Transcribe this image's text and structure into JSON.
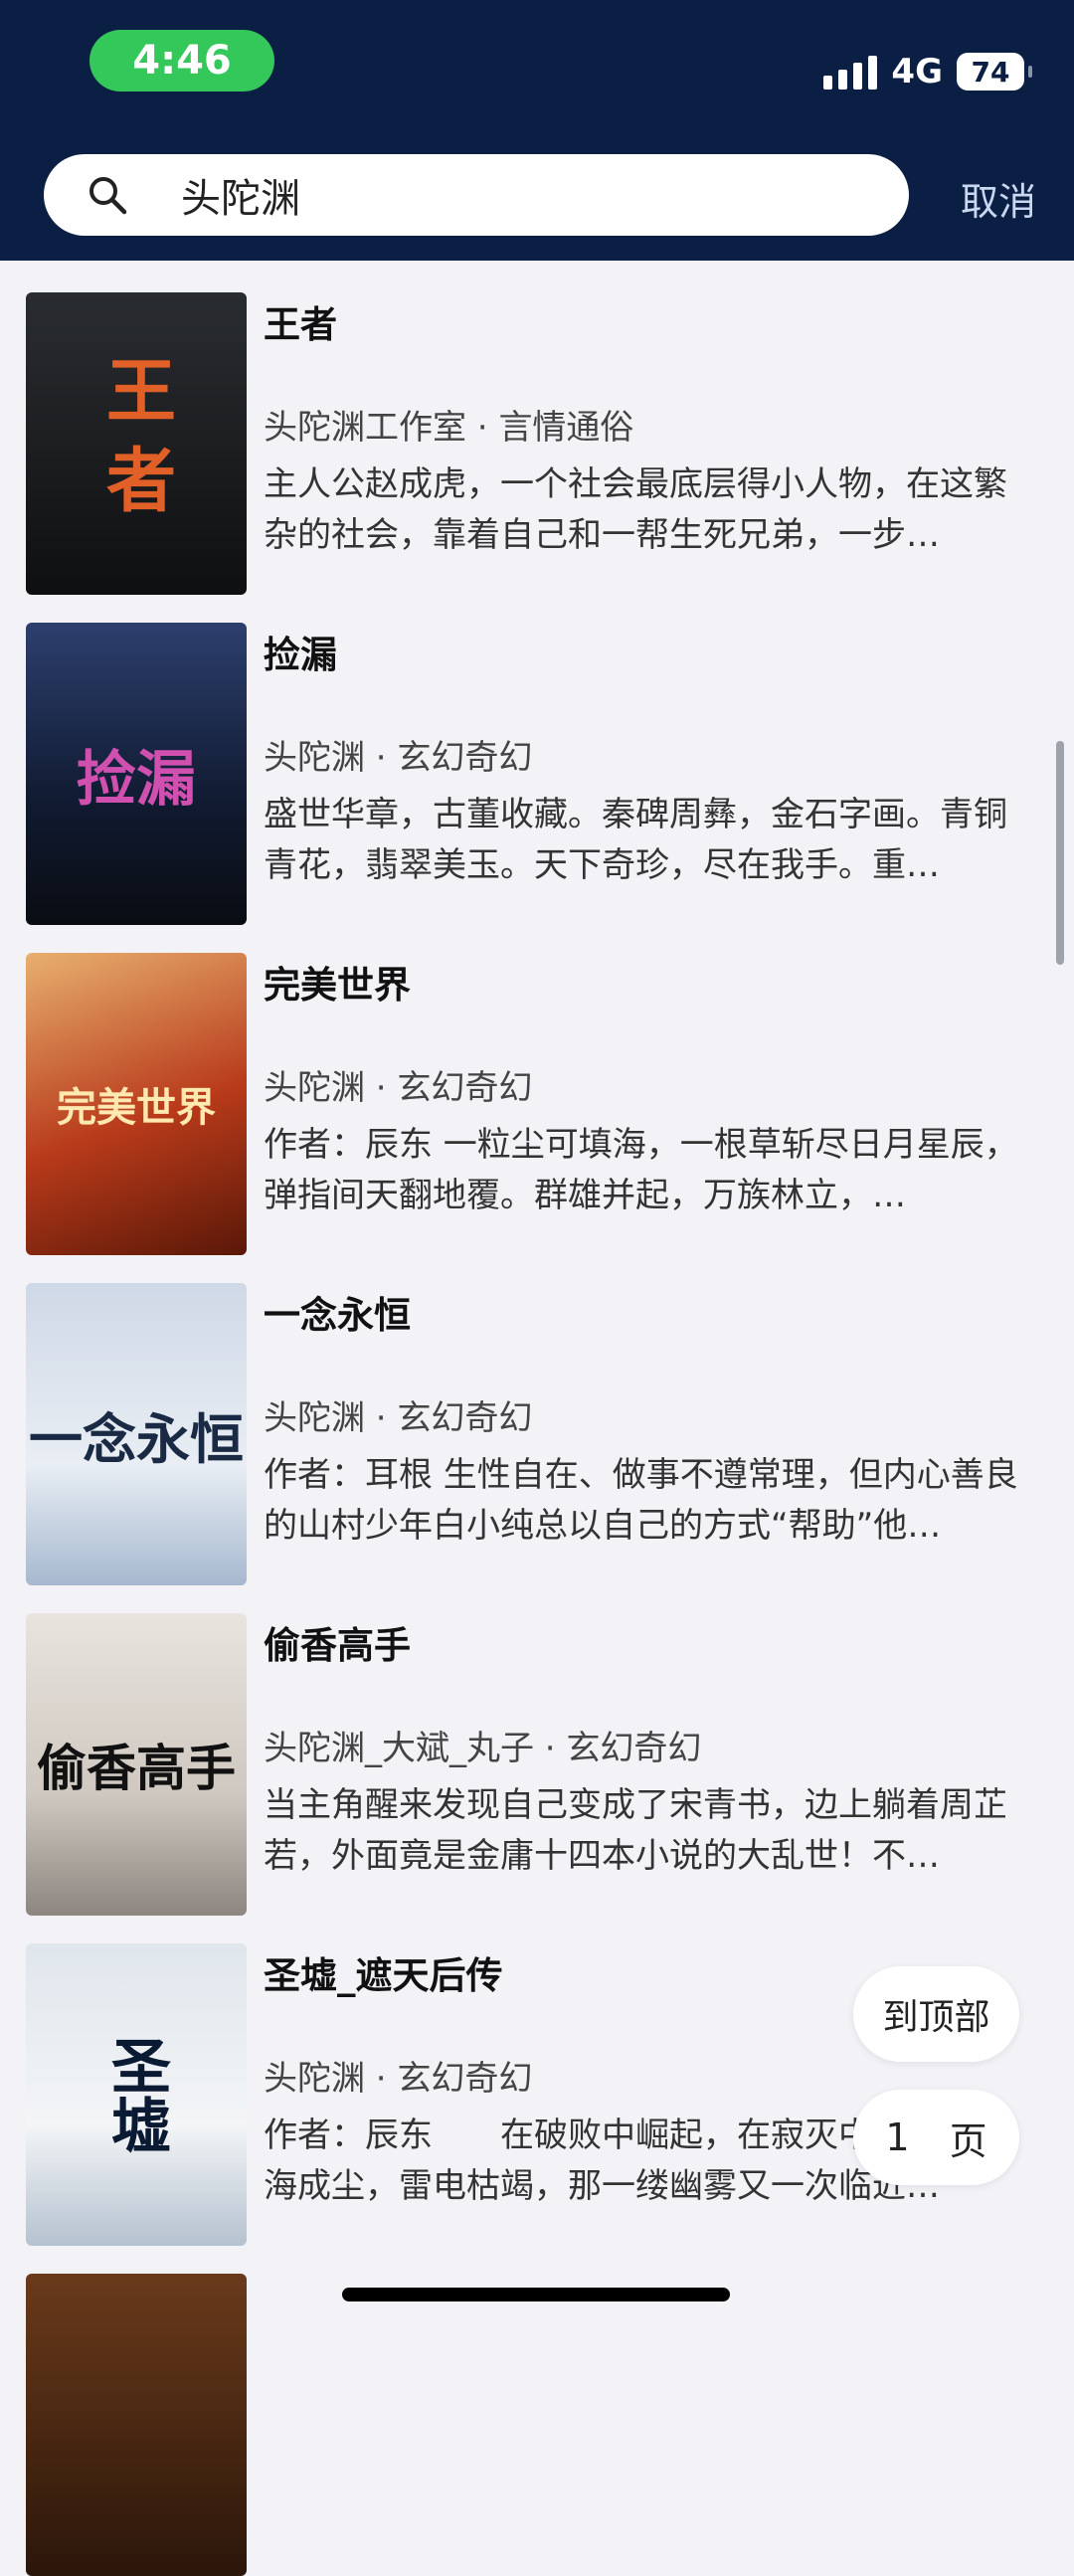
{
  "status": {
    "time": "4:46",
    "network": "4G",
    "battery": "74"
  },
  "search": {
    "query": "头陀渊",
    "cancel_label": "取消"
  },
  "results": [
    {
      "title": "王者",
      "author": "头陀渊工作室",
      "category": "言情通俗",
      "description": "主人公赵成虎，一个社会最底层得小人物，在这繁杂的社会，靠着自己和一帮生死兄弟，一步…",
      "cover_text": "王者"
    },
    {
      "title": "捡漏",
      "author": "头陀渊",
      "category": "玄幻奇幻",
      "description": "盛世华章，古董收藏。秦碑周彝，金石字画。青铜青花，翡翠美玉。天下奇珍，尽在我手。重…",
      "cover_text": "捡漏"
    },
    {
      "title": "完美世界",
      "author": "头陀渊",
      "category": "玄幻奇幻",
      "description": "作者：辰东 一粒尘可填海，一根草斩尽日月星辰，弹指间天翻地覆。群雄并起，万族林立，…",
      "cover_text": "完美世界"
    },
    {
      "title": "一念永恒",
      "author": "头陀渊",
      "category": "玄幻奇幻",
      "description": "作者：耳根 生性自在、做事不遵常理，但内心善良的山村少年白小纯总以自己的方式“帮助”他…",
      "cover_text": "一念永恒"
    },
    {
      "title": "偷香高手",
      "author": "头陀渊_大斌_丸子",
      "category": "玄幻奇幻",
      "description": "当主角醒来发现自己变成了宋青书，边上躺着周芷若，外面竟是金庸十四本小说的大乱世！不…",
      "cover_text": "偷香高手"
    },
    {
      "title": "圣墟_遮天后传",
      "author": "头陀渊",
      "category": "玄幻奇幻",
      "description": "作者：辰东　　在破败中崛起，在寂灭中复苏。沧海成尘，雷电枯竭，那一缕幽雾又一次临近…",
      "cover_text": "圣墟"
    }
  ],
  "floating": {
    "to_top_label": "到顶部",
    "page_number": "1",
    "page_unit": "页"
  }
}
